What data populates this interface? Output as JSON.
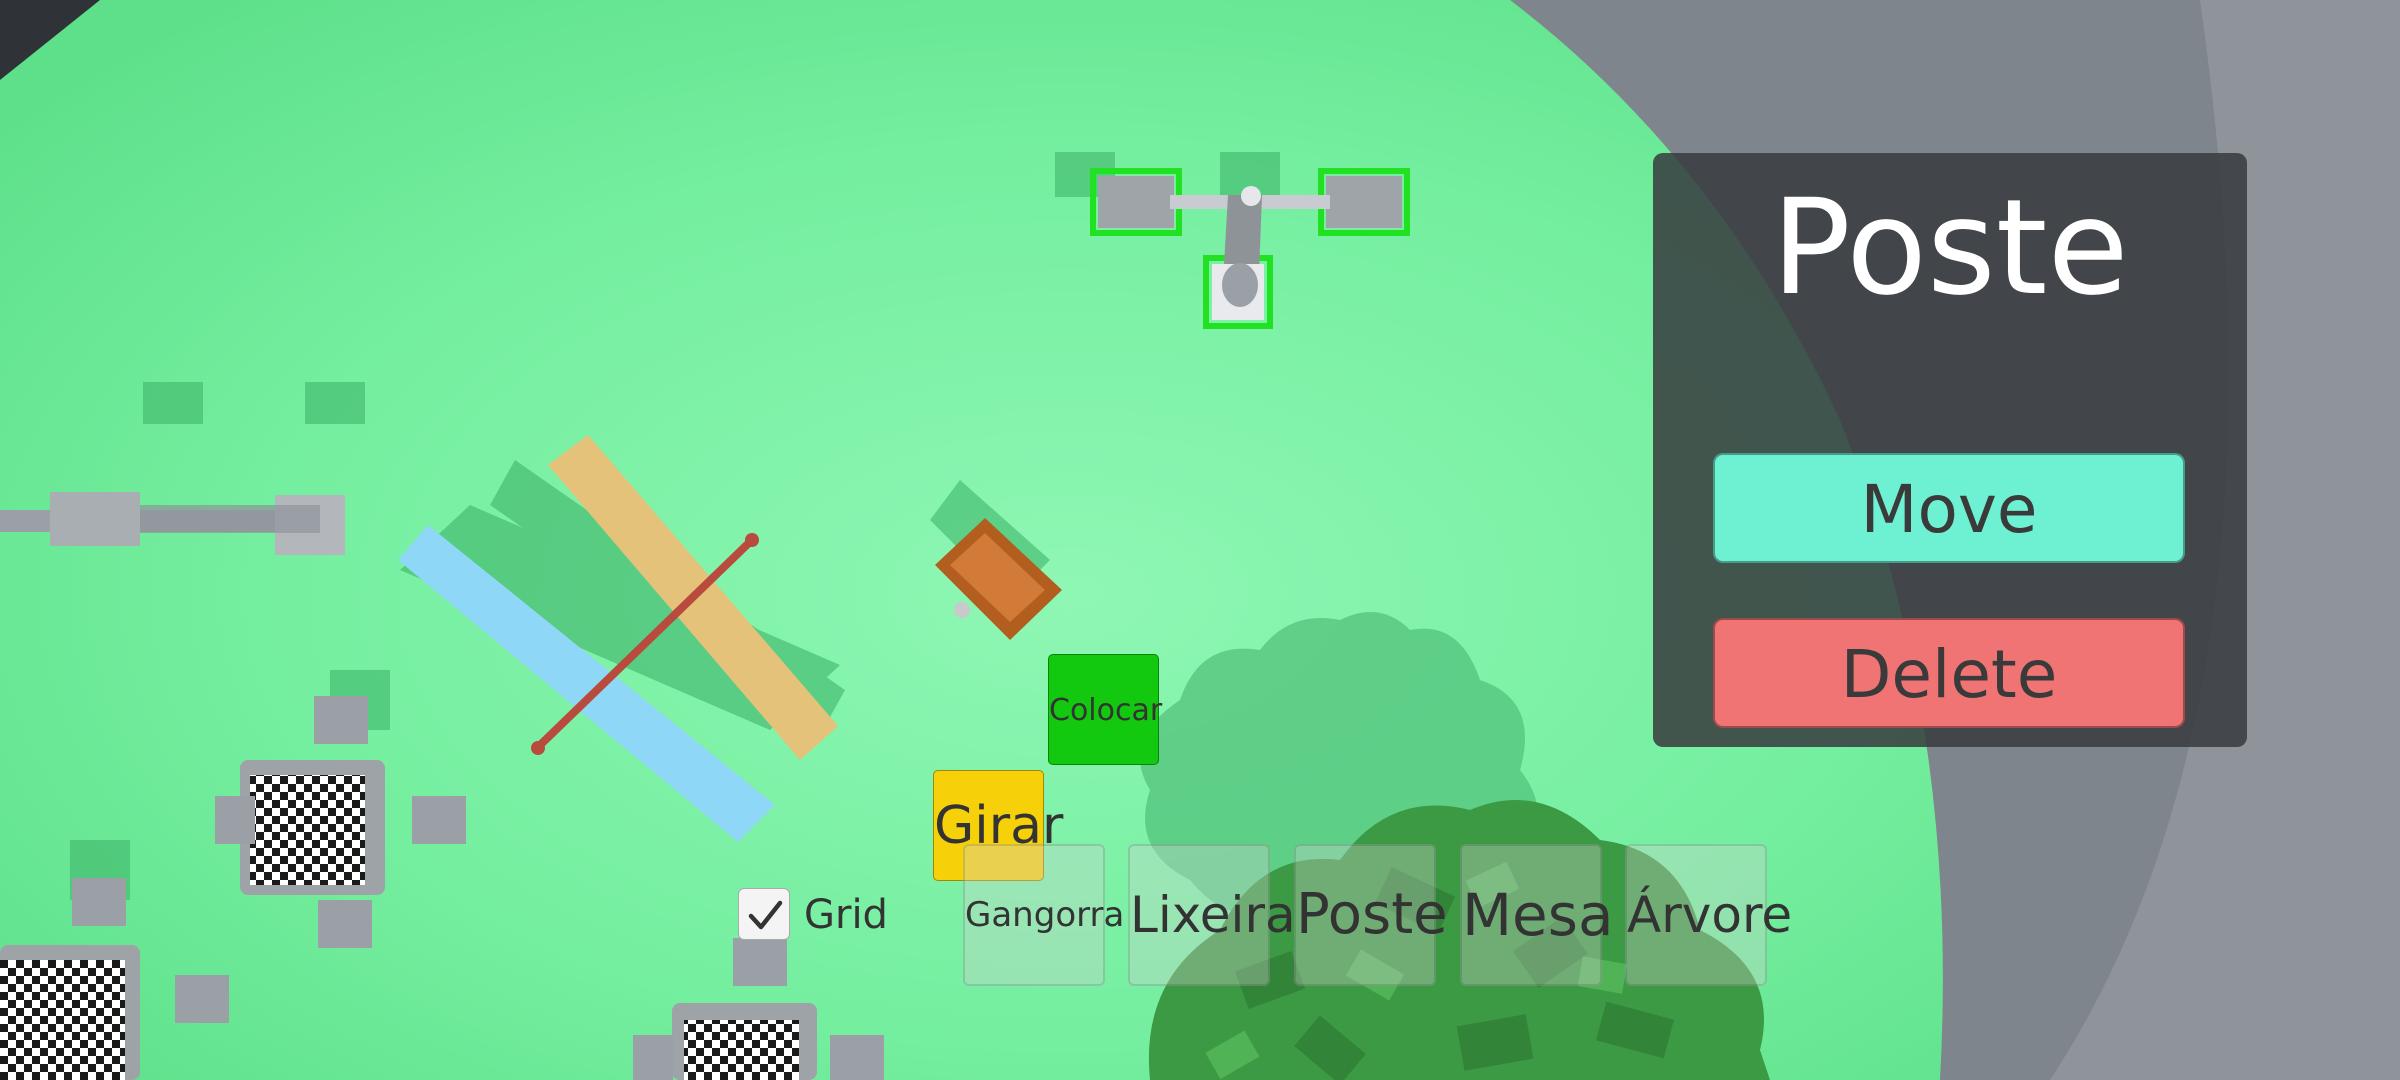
{
  "selected_panel": {
    "title": "Poste",
    "move_label": "Move",
    "delete_label": "Delete"
  },
  "actions": {
    "place_label": "Colocar",
    "rotate_label": "Girar"
  },
  "grid": {
    "label": "Grid",
    "checked": true
  },
  "item_bar": [
    {
      "label": "Gangorra"
    },
    {
      "label": "Lixeira"
    },
    {
      "label": "Poste"
    },
    {
      "label": "Mesa"
    },
    {
      "label": "Árvore"
    }
  ],
  "colors": {
    "grass": "#6ee89a",
    "move_button": "#6ef0d2",
    "delete_button": "#f07474",
    "place_button": "#12c90f",
    "rotate_button": "#f6d009",
    "selection_outline": "#22e022"
  }
}
